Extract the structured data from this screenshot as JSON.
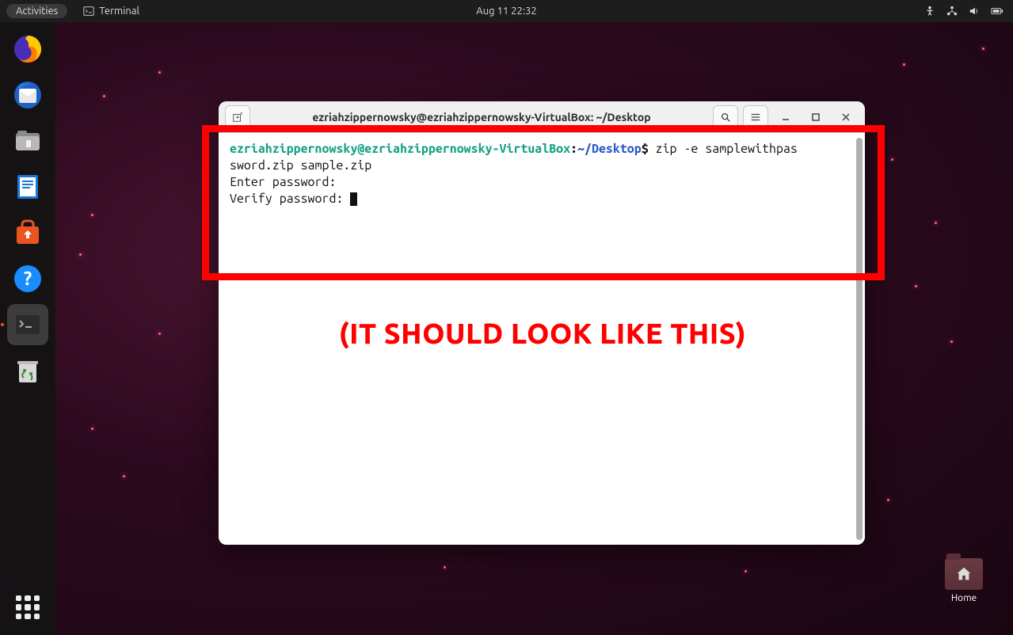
{
  "topbar": {
    "activities": "Activities",
    "app_label": "Terminal",
    "clock": "Aug 11  22:32"
  },
  "dock": {
    "items": [
      {
        "name": "firefox"
      },
      {
        "name": "thunderbird"
      },
      {
        "name": "files"
      },
      {
        "name": "libreoffice-writer"
      },
      {
        "name": "ubuntu-software"
      },
      {
        "name": "help"
      },
      {
        "name": "terminal"
      },
      {
        "name": "trash"
      }
    ]
  },
  "desktop_icon": {
    "label": "Home"
  },
  "window": {
    "title": "ezriahzippernowsky@ezriahzippernowsky-VirtualBox: ~/Desktop",
    "prompt_user_host": "ezriahzippernowsky@ezriahzippernowsky-VirtualBox",
    "prompt_separator": ":",
    "prompt_path": "~/Desktop",
    "prompt_symbol": "$",
    "command": " zip -e samplewithpas",
    "command_wrap": "sword.zip sample.zip",
    "line_enter": "Enter password:",
    "line_verify": "Verify password: "
  },
  "annotation": {
    "text": "(IT SHOULD LOOK LIKE THIS)"
  }
}
